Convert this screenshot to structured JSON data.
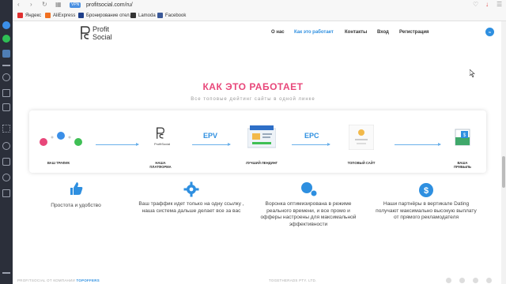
{
  "browser": {
    "url": "profitsocial.com/ru/",
    "vpn_label": "VPN",
    "bookmarks": [
      "Яндекс",
      "AliExpress",
      "Бронирование отел...",
      "Lamoda",
      "Facebook"
    ]
  },
  "header": {
    "logo_line1": "Profit",
    "logo_line2": "Social",
    "nav": [
      "О нас",
      "Как это работает",
      "Контакты",
      "Вход",
      "Регистрация"
    ],
    "lang": "ru"
  },
  "hero": {
    "title": "КАК ЭТО РАБОТАЕТ",
    "subtitle": "Все топовые дейтинг сайты в одной линке"
  },
  "flow": {
    "steps": [
      {
        "label": "ВАШ ТРАФИК"
      },
      {
        "label": "НАША ПЛАТФОРМА",
        "mini_logo": "ProfitSocial"
      },
      {
        "label": "ЛУЧШИЙ ЛЕНДИНГ"
      },
      {
        "label": "ТОПОВЫЙ САЙТ"
      },
      {
        "label": "ВАША ПРИБЫЛЬ"
      }
    ],
    "metrics": [
      "EPV",
      "EPC"
    ]
  },
  "features": [
    {
      "icon": "thumbs-up-icon",
      "text": "Простота и удобство"
    },
    {
      "icon": "gear-icon",
      "text": "Ваш траффик идет только на одну ссылку , наша система дальше делает все за вас"
    },
    {
      "icon": "bubbles-icon",
      "text": "Воронка оптимизирована в режиме реального времени, и все промо и офферы настроены для максимальной эффективности"
    },
    {
      "icon": "dollar-icon",
      "text": "Наши партнёры в вертикале Dating получают максимально высокую выплату от прямого рекламодателя"
    }
  ],
  "footer": {
    "left": "PROFITSOCIAL ОТ КОМПАНИИ",
    "left_brand": "TOPOFFERS",
    "middle": "TOGETHERADS PTY. LTD."
  },
  "colors": {
    "accent": "#2e8fe0",
    "title": "#e8477a"
  }
}
